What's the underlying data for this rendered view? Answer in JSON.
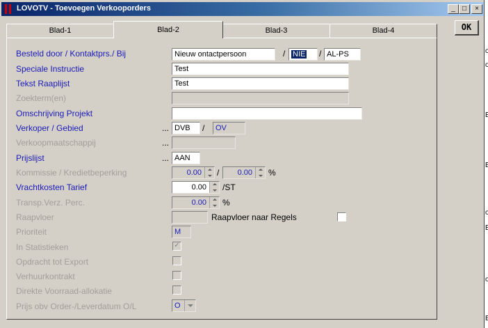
{
  "window": {
    "title": "LOVOTV - Toevoegen Verkooporders"
  },
  "caption_buttons": {
    "minimize": "_",
    "maximize": "□",
    "close": "×"
  },
  "ok_button": "OK",
  "tabs": [
    "Blad-1",
    "Blad-2",
    "Blad-3",
    "Blad-4"
  ],
  "active_tab": "Blad-2",
  "form": {
    "besteld_door": {
      "label": "Besteld door / Kontaktprs./ Bij",
      "value": "Nieuw ontactpersoon",
      "code1": "NIE",
      "code2": "AL-PS"
    },
    "speciale_instructie": {
      "label": "Speciale Instructie",
      "value": "Test"
    },
    "tekst_raaplijst": {
      "label": "Tekst Raaplijst",
      "value": "Test"
    },
    "zoekterm": {
      "label": "Zoekterm(en)",
      "value": ""
    },
    "omschrijving_projekt": {
      "label": "Omschrijving Projekt",
      "value": ""
    },
    "verkoper": {
      "label": "Verkoper / Gebied",
      "prefix": "...",
      "value": "DVB",
      "gebied": "OV"
    },
    "verkoopmaatschappij": {
      "label": "Verkoopmaatschappij",
      "prefix": "...",
      "value": ""
    },
    "prijslijst": {
      "label": "Prijslijst",
      "prefix": "...",
      "value": "AAN"
    },
    "kommissie": {
      "label": "Kommissie / Kredietbeperking",
      "value1": "0.00",
      "value2": "0.00",
      "unit": "%"
    },
    "vrachtkosten": {
      "label": "Vrachtkosten Tarief",
      "value": "0.00",
      "unit": "/ST"
    },
    "transp": {
      "label": "Transp.Verz. Perc.",
      "value": "0.00",
      "unit": "%"
    },
    "raapvloer": {
      "label": "Raapvloer",
      "value": "",
      "naar_regels_label": "Raapvloer naar Regels"
    },
    "prioriteit": {
      "label": "Prioriteit",
      "value": "M"
    },
    "in_statistieken": {
      "label": "In Statistieken",
      "checked": true
    },
    "opdracht_export": {
      "label": "Opdracht tot Export",
      "checked": false
    },
    "verhuurkontrakt": {
      "label": "Verhuurkontrakt",
      "checked": false
    },
    "direkte_voorraad": {
      "label": "Direkte Voorraad-allokatie",
      "checked": false
    },
    "prijs_obv": {
      "label": "Prijs obv Order-/Leverdatum O/L",
      "value": "O"
    }
  },
  "background_window": {
    "letters": [
      "o",
      "o",
      "E",
      "B",
      "o",
      "E",
      "o",
      "B"
    ]
  }
}
